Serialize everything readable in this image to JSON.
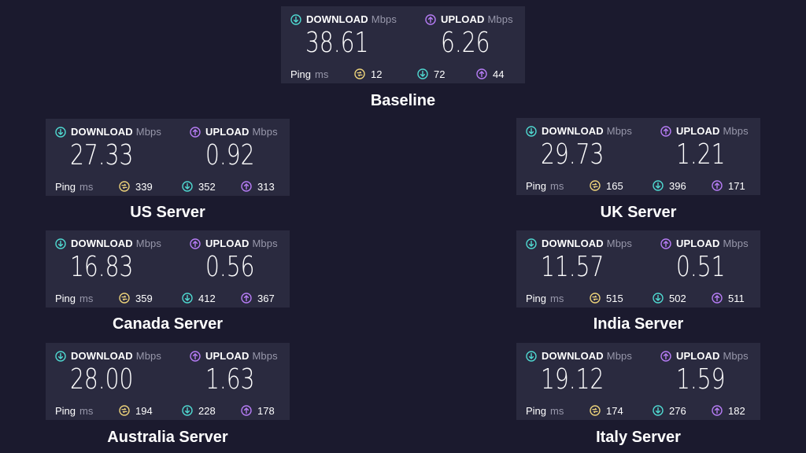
{
  "labels": {
    "download": "DOWNLOAD",
    "upload": "UPLOAD",
    "speed_unit": "Mbps",
    "ping": "Ping",
    "ping_unit": "ms"
  },
  "colors": {
    "background": "#1b1a2e",
    "card": "#2a2a3f",
    "download_accent": "#4fd8d0",
    "upload_accent": "#b67cf5",
    "ping_accent": "#ecd27a"
  },
  "icons": {
    "download": "arrow-down-circle-icon",
    "upload": "arrow-up-circle-icon",
    "ping": "jitter-circle-icon"
  },
  "tests": [
    {
      "name": "Baseline",
      "download": "38.61",
      "upload": "6.26",
      "ping": "12",
      "ping_down": "72",
      "ping_up": "44"
    },
    {
      "name": "US Server",
      "download": "27.33",
      "upload": "0.92",
      "ping": "339",
      "ping_down": "352",
      "ping_up": "313"
    },
    {
      "name": "UK Server",
      "download": "29.73",
      "upload": "1.21",
      "ping": "165",
      "ping_down": "396",
      "ping_up": "171"
    },
    {
      "name": "Canada Server",
      "download": "16.83",
      "upload": "0.56",
      "ping": "359",
      "ping_down": "412",
      "ping_up": "367"
    },
    {
      "name": "India Server",
      "download": "11.57",
      "upload": "0.51",
      "ping": "515",
      "ping_down": "502",
      "ping_up": "511"
    },
    {
      "name": "Australia Server",
      "download": "28.00",
      "upload": "1.63",
      "ping": "194",
      "ping_down": "228",
      "ping_up": "178"
    },
    {
      "name": "Italy Server",
      "download": "19.12",
      "upload": "1.59",
      "ping": "174",
      "ping_down": "276",
      "ping_up": "182"
    }
  ]
}
